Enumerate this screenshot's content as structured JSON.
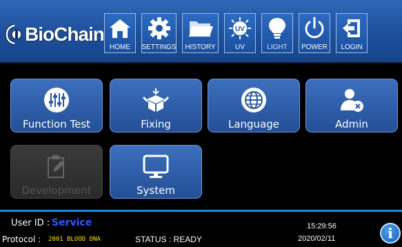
{
  "brand": {
    "name": "BioChain",
    "reg": "®"
  },
  "nav": [
    {
      "label": "HOME",
      "icon": "home-icon"
    },
    {
      "label": "SETTINGS",
      "icon": "gear-icon"
    },
    {
      "label": "HISTORY",
      "icon": "folder-icon"
    },
    {
      "label": "UV",
      "icon": "uv-icon"
    },
    {
      "label": "LIGHT",
      "icon": "lightbulb-icon"
    },
    {
      "label": "POWER",
      "icon": "power-icon"
    },
    {
      "label": "LOGIN",
      "icon": "login-icon"
    }
  ],
  "tiles": [
    {
      "label": "Function Test",
      "icon": "sliders-icon",
      "enabled": true
    },
    {
      "label": "Fixing",
      "icon": "box-icon",
      "enabled": true
    },
    {
      "label": "Language",
      "icon": "globe-icon",
      "enabled": true
    },
    {
      "label": "Admin",
      "icon": "admin-user-icon",
      "enabled": true
    },
    {
      "label": "Development",
      "icon": "edit-document-icon",
      "enabled": false
    },
    {
      "label": "System",
      "icon": "monitor-icon",
      "enabled": true
    }
  ],
  "status": {
    "user_id_label": "User ID :",
    "user_id_value": "Service",
    "protocol_label": "Protocol :",
    "protocol_value": "2001 BLOOD DNA",
    "status_text": "STATUS : READY",
    "time": "15:29:56",
    "date": "2020/02/11",
    "info_glyph": "i"
  },
  "colors": {
    "header": "#1d4f9b",
    "tile": "#2f5ea8",
    "accent_line": "#1d8be0",
    "user_id": "#2f57ff",
    "protocol": "#ffe400"
  }
}
